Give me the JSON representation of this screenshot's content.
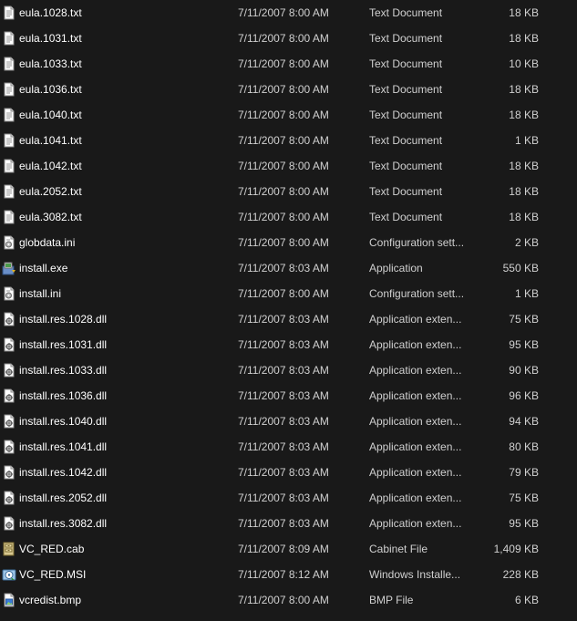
{
  "files": [
    {
      "name": "eula.1028.txt",
      "modified": "7/11/2007 8:00 AM",
      "type": "Text Document",
      "size": "18 KB",
      "icon": "text-document-icon"
    },
    {
      "name": "eula.1031.txt",
      "modified": "7/11/2007 8:00 AM",
      "type": "Text Document",
      "size": "18 KB",
      "icon": "text-document-icon"
    },
    {
      "name": "eula.1033.txt",
      "modified": "7/11/2007 8:00 AM",
      "type": "Text Document",
      "size": "10 KB",
      "icon": "text-document-icon"
    },
    {
      "name": "eula.1036.txt",
      "modified": "7/11/2007 8:00 AM",
      "type": "Text Document",
      "size": "18 KB",
      "icon": "text-document-icon"
    },
    {
      "name": "eula.1040.txt",
      "modified": "7/11/2007 8:00 AM",
      "type": "Text Document",
      "size": "18 KB",
      "icon": "text-document-icon"
    },
    {
      "name": "eula.1041.txt",
      "modified": "7/11/2007 8:00 AM",
      "type": "Text Document",
      "size": "1 KB",
      "icon": "text-document-icon"
    },
    {
      "name": "eula.1042.txt",
      "modified": "7/11/2007 8:00 AM",
      "type": "Text Document",
      "size": "18 KB",
      "icon": "text-document-icon"
    },
    {
      "name": "eula.2052.txt",
      "modified": "7/11/2007 8:00 AM",
      "type": "Text Document",
      "size": "18 KB",
      "icon": "text-document-icon"
    },
    {
      "name": "eula.3082.txt",
      "modified": "7/11/2007 8:00 AM",
      "type": "Text Document",
      "size": "18 KB",
      "icon": "text-document-icon"
    },
    {
      "name": "globdata.ini",
      "modified": "7/11/2007 8:00 AM",
      "type": "Configuration sett...",
      "size": "2 KB",
      "icon": "config-file-icon"
    },
    {
      "name": "install.exe",
      "modified": "7/11/2007 8:03 AM",
      "type": "Application",
      "size": "550 KB",
      "icon": "installer-app-icon"
    },
    {
      "name": "install.ini",
      "modified": "7/11/2007 8:00 AM",
      "type": "Configuration sett...",
      "size": "1 KB",
      "icon": "config-file-icon"
    },
    {
      "name": "install.res.1028.dll",
      "modified": "7/11/2007 8:03 AM",
      "type": "Application exten...",
      "size": "75 KB",
      "icon": "dll-file-icon"
    },
    {
      "name": "install.res.1031.dll",
      "modified": "7/11/2007 8:03 AM",
      "type": "Application exten...",
      "size": "95 KB",
      "icon": "dll-file-icon"
    },
    {
      "name": "install.res.1033.dll",
      "modified": "7/11/2007 8:03 AM",
      "type": "Application exten...",
      "size": "90 KB",
      "icon": "dll-file-icon"
    },
    {
      "name": "install.res.1036.dll",
      "modified": "7/11/2007 8:03 AM",
      "type": "Application exten...",
      "size": "96 KB",
      "icon": "dll-file-icon"
    },
    {
      "name": "install.res.1040.dll",
      "modified": "7/11/2007 8:03 AM",
      "type": "Application exten...",
      "size": "94 KB",
      "icon": "dll-file-icon"
    },
    {
      "name": "install.res.1041.dll",
      "modified": "7/11/2007 8:03 AM",
      "type": "Application exten...",
      "size": "80 KB",
      "icon": "dll-file-icon"
    },
    {
      "name": "install.res.1042.dll",
      "modified": "7/11/2007 8:03 AM",
      "type": "Application exten...",
      "size": "79 KB",
      "icon": "dll-file-icon"
    },
    {
      "name": "install.res.2052.dll",
      "modified": "7/11/2007 8:03 AM",
      "type": "Application exten...",
      "size": "75 KB",
      "icon": "dll-file-icon"
    },
    {
      "name": "install.res.3082.dll",
      "modified": "7/11/2007 8:03 AM",
      "type": "Application exten...",
      "size": "95 KB",
      "icon": "dll-file-icon"
    },
    {
      "name": "VC_RED.cab",
      "modified": "7/11/2007 8:09 AM",
      "type": "Cabinet File",
      "size": "1,409 KB",
      "icon": "cabinet-file-icon"
    },
    {
      "name": "VC_RED.MSI",
      "modified": "7/11/2007 8:12 AM",
      "type": "Windows Installe...",
      "size": "228 KB",
      "icon": "msi-installer-icon"
    },
    {
      "name": "vcredist.bmp",
      "modified": "7/11/2007 8:00 AM",
      "type": "BMP File",
      "size": "6 KB",
      "icon": "bitmap-file-icon"
    }
  ],
  "colors": {
    "background": "#191919",
    "name_text": "#ffffff",
    "detail_text": "#d0d0d0"
  }
}
